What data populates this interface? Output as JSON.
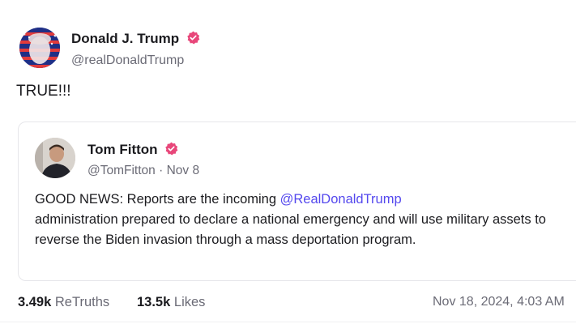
{
  "post": {
    "author_name": "Donald J. Trump",
    "author_handle": "@realDonaldTrump",
    "text": "TRUE!!!"
  },
  "quote": {
    "author_name": "Tom Fitton",
    "author_handle": "@TomFitton",
    "separator": "·",
    "date": "Nov 8",
    "text_before": "GOOD NEWS: Reports are the incoming ",
    "mention": "@RealDonaldTrump",
    "text_after": " administration prepared to declare a national emergency and will use military assets to reverse the Biden invasion through a mass deportation program."
  },
  "stats": {
    "retruths_count": "3.49k",
    "retruths_label": "ReTruths",
    "likes_count": "13.5k",
    "likes_label": "Likes",
    "timestamp": "Nov 18, 2024, 4:03 AM"
  },
  "icons": {
    "verified": "verified-badge-icon"
  },
  "colors": {
    "verified_badge": "#e8477a",
    "mention": "#5448ee",
    "secondary_text": "#6b6b76"
  }
}
